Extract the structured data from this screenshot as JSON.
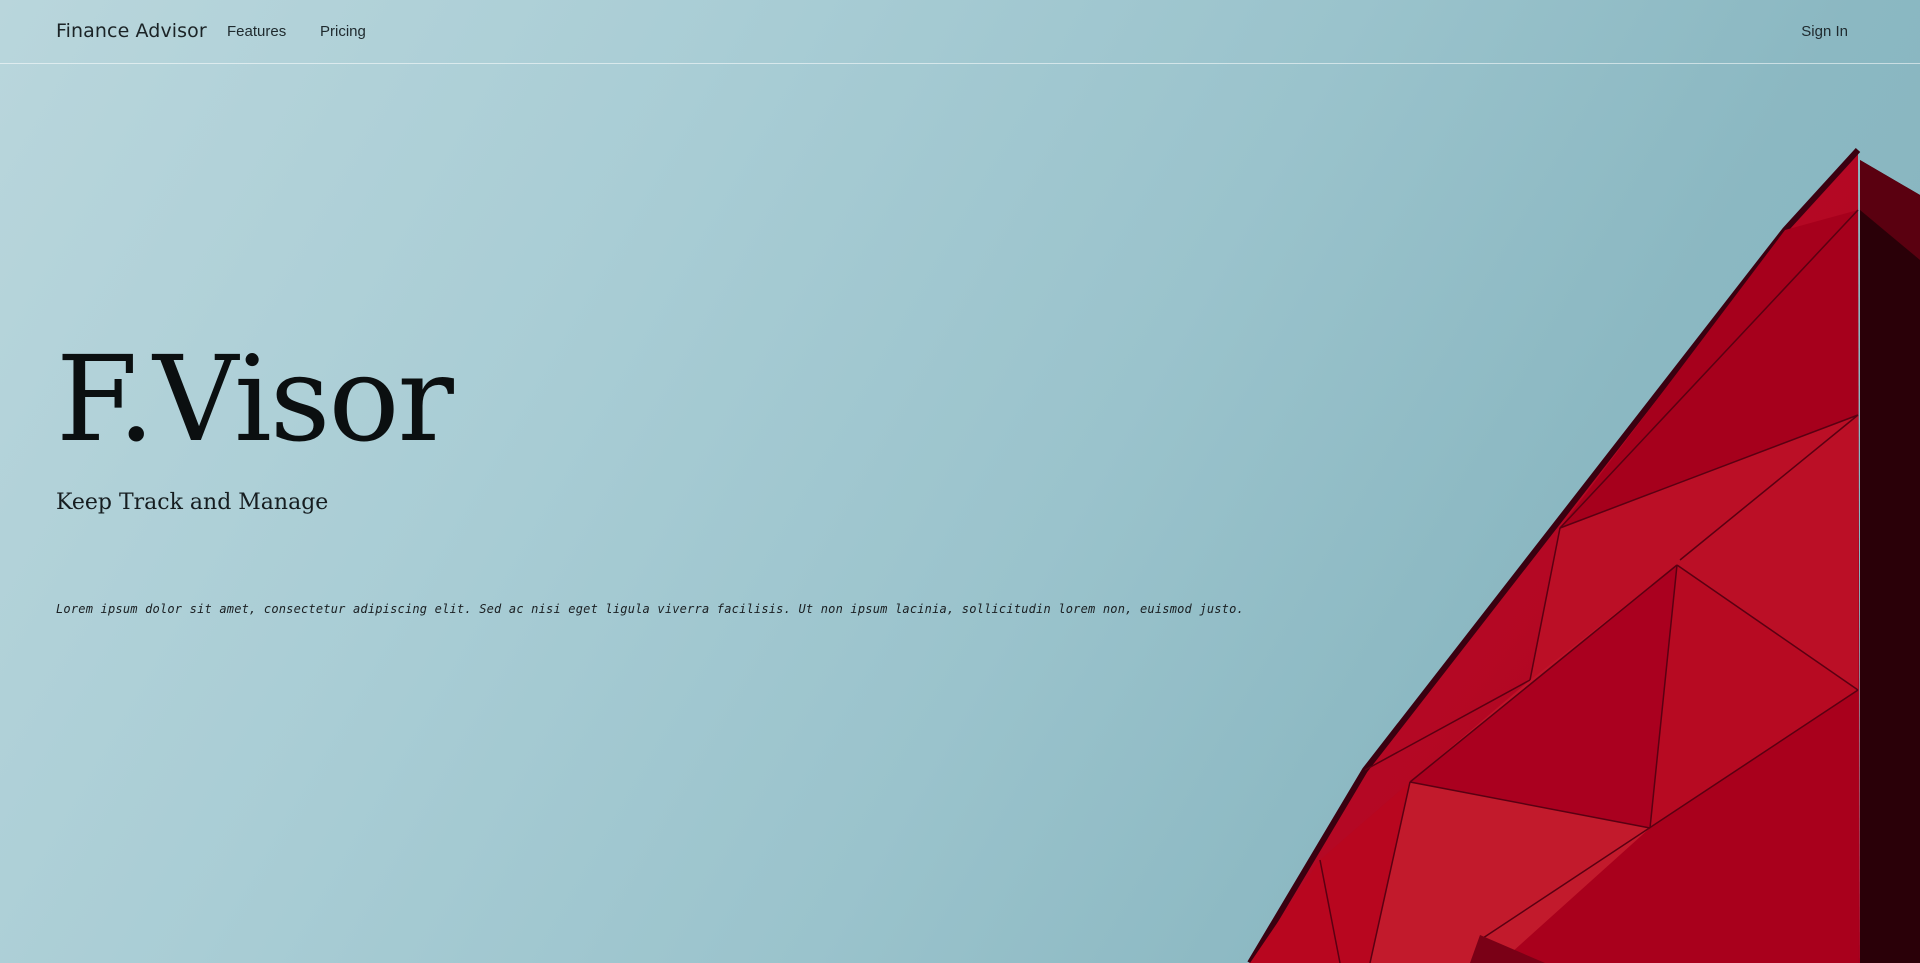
{
  "nav": {
    "brand": "Finance Advisor",
    "links": [
      {
        "label": "Features"
      },
      {
        "label": "Pricing"
      }
    ],
    "sign_in": "Sign In"
  },
  "hero": {
    "title": "F.Visor",
    "subtitle": "Keep Track and Manage",
    "body": "Lorem ipsum dolor sit amet, consectetur adipiscing elit. Sed ac nisi eget ligula viverra facilisis. Ut non ipsum lacinia, sollicitudin lorem non, euismod justo."
  },
  "colors": {
    "sky_light": "#b9d6dc",
    "sky_dark": "#85b3be",
    "building_red": "#b5001f",
    "building_shadow": "#2a0008",
    "text_dark": "#0b0f10"
  }
}
